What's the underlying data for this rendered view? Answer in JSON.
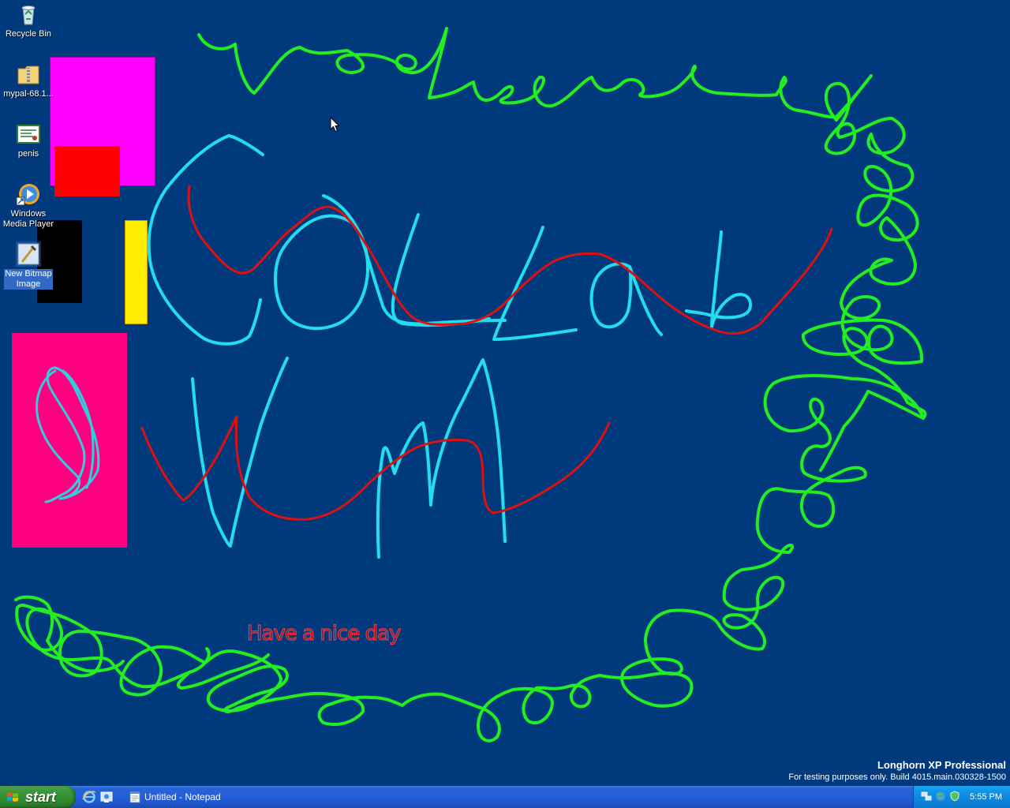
{
  "desktop": {
    "icons": [
      {
        "label": "Recycle Bin",
        "icon": "recycle-bin-icon"
      },
      {
        "label": "mypal-68.1...",
        "icon": "zip-folder-icon"
      },
      {
        "label": "penis",
        "icon": "certificate-icon"
      },
      {
        "label": "Windows\nMedia Player",
        "icon": "media-player-icon"
      },
      {
        "label": "New Bitmap\nImage",
        "icon": "bitmap-image-icon"
      }
    ],
    "drawn_text": "Have a nice day",
    "colors": {
      "background": "#003a7c",
      "green": "#22ee22",
      "cyan": "#22ddee",
      "red": "#dd1111",
      "magenta": "#ff00ff",
      "pink": "#ff0080",
      "yellow": "#ffee00"
    }
  },
  "watermark": {
    "line1": "Longhorn XP Professional",
    "line2": "For testing purposes only. Build 4015.main.030328-1500"
  },
  "taskbar": {
    "start_label": "start",
    "quick_launch": [
      "internet-explorer-icon",
      "show-desktop-icon"
    ],
    "tasks": [
      {
        "label": "Untitled - Notepad",
        "icon": "notepad-icon"
      }
    ],
    "tray_icons": [
      "network-icon",
      "globe-icon",
      "security-icon"
    ],
    "clock": "5:55 PM"
  }
}
